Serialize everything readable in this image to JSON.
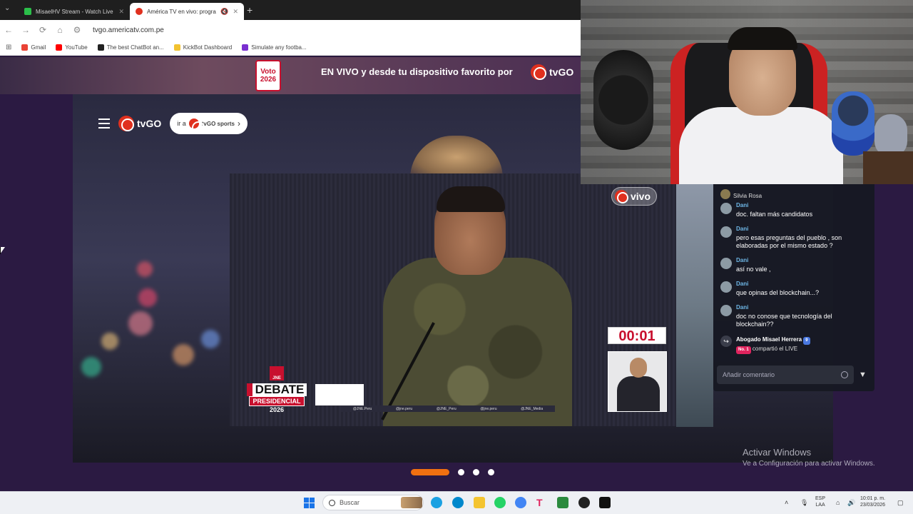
{
  "browser": {
    "tabs": [
      {
        "title": "MisaelHV Stream - Watch Live",
        "color": "#2bbf4a"
      },
      {
        "title": "América TV en vivo: progra",
        "color": "#e0301e"
      }
    ],
    "url": "tvgo.americatv.com.pe",
    "bookmarks": [
      {
        "label": "Gmail",
        "color": "#ea4335"
      },
      {
        "label": "YouTube",
        "color": "#ff0000"
      },
      {
        "label": "The best ChatBot an...",
        "color": "#222222"
      },
      {
        "label": "KickBot Dashboard",
        "color": "#f2c230"
      },
      {
        "label": "Simulate any footba...",
        "color": "#7a2fd0"
      }
    ]
  },
  "site": {
    "voto_line1": "Voto",
    "voto_line2": "2026",
    "banner_text": "EN VIVO y desde tu dispositivo favorito por",
    "brand": "tvGO",
    "goto_prefix": "ir a",
    "goto_brand": "tvGO sports"
  },
  "player": {
    "live_label": "vivo",
    "timer": "00:01",
    "debate_line1": "DEBATE",
    "debate_line2": "PRESIDENCIAL",
    "debate_line3": "2026",
    "jne_label": "JNE",
    "socials": [
      "@JNE.Peru",
      "@jne.peru",
      "@JNE_Peru",
      "@jne.peru",
      "@JNE_Media"
    ]
  },
  "chat": {
    "top_user": "Silvia Rosa",
    "messages": [
      {
        "user": "Dani",
        "text": "doc. faltan más candidatos"
      },
      {
        "user": "Dani",
        "text": "pero esas preguntas del pueblo , son elaboradas por el mismo estado ?"
      },
      {
        "user": "Dani",
        "text": "así no vale ,"
      },
      {
        "user": "Dani",
        "text": "que opinas del blockchain...?"
      },
      {
        "user": "Dani",
        "text": "doc no conose que tecnología del blockchain??"
      }
    ],
    "share_user": "Abogado Misael Herrera",
    "share_badge_level": "9",
    "share_badge_rank": "No. 1",
    "share_action": "compartió el LIVE",
    "comment_placeholder": "Añadir comentario"
  },
  "watermark": {
    "line1": "Activar Windows",
    "line2": "Ve a Configuración para activar Windows."
  },
  "carousel": {
    "count": 4,
    "active": 0
  },
  "taskbar": {
    "search_placeholder": "Buscar",
    "lang1": "ESP",
    "lang2": "LAA",
    "time": "10:01 p. m.",
    "date": "23/03/2026",
    "app_colors": [
      "#1ba1e2",
      "#0088cc",
      "#f4c430",
      "#25d366",
      "#4285f4",
      "#e0245e",
      "#2b8a3e",
      "#222222",
      "#111111"
    ]
  },
  "colors": {
    "accent": "#f07010",
    "brand_red": "#e0301e"
  }
}
